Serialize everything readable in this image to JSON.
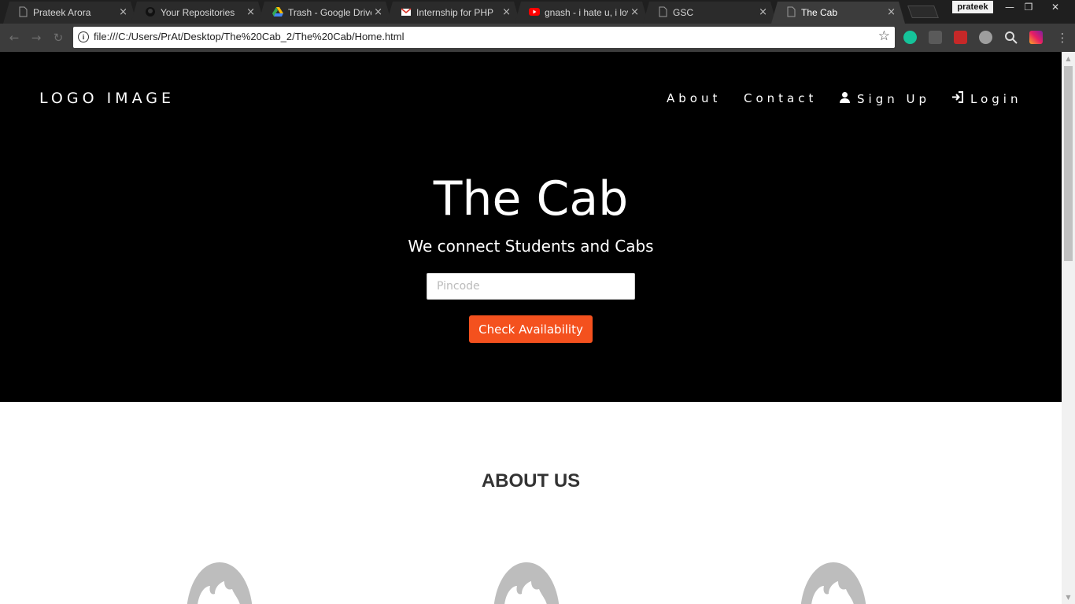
{
  "browser": {
    "tabs": [
      {
        "title": "Prateek Arora",
        "icon": "document-icon"
      },
      {
        "title": "Your Repositories",
        "icon": "github-icon"
      },
      {
        "title": "Trash - Google Drive",
        "icon": "google-drive-icon"
      },
      {
        "title": "Internship for PHP",
        "icon": "gmail-icon"
      },
      {
        "title": "gnash - i hate u, i love u",
        "icon": "youtube-icon"
      },
      {
        "title": "GSC",
        "icon": "document-icon"
      },
      {
        "title": "The Cab",
        "icon": "document-icon"
      }
    ],
    "close_glyph": "×",
    "profile_name": "prateek",
    "url": "file:///C:/Users/PrAt/Desktop/The%20Cab_2/The%20Cab/Home.html"
  },
  "page": {
    "logo": "LOGO IMAGE",
    "nav": {
      "about": "About",
      "contact": "Contact",
      "signup": "Sign Up",
      "login": "Login"
    },
    "hero": {
      "title": "The Cab",
      "subtitle": "We connect Students and Cabs",
      "pincode_placeholder": "Pincode",
      "button": "Check Availability"
    },
    "about": {
      "title": "ABOUT US"
    }
  },
  "colors": {
    "accent": "#f4511e",
    "hero_bg": "#000000",
    "avatar": "#bdbdbd"
  }
}
